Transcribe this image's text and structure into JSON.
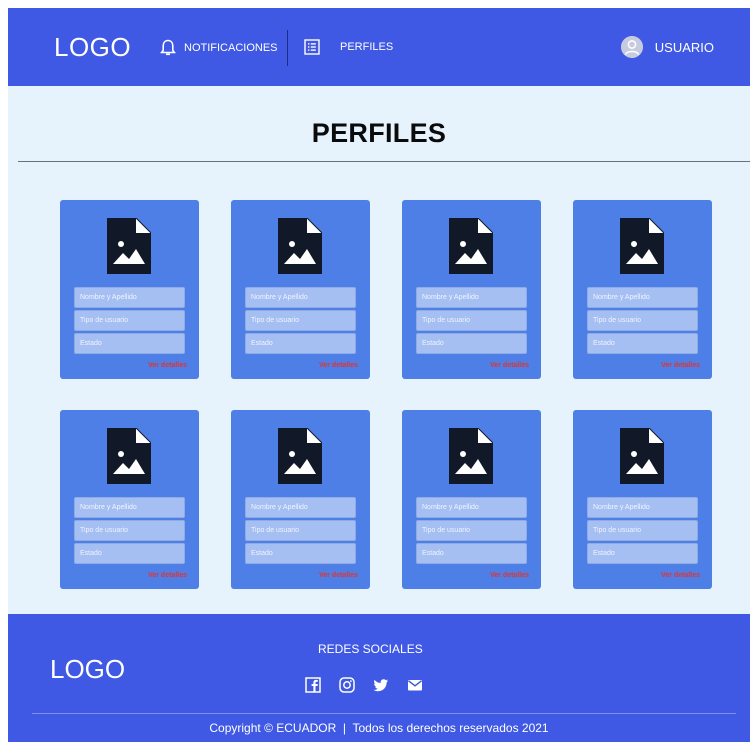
{
  "header": {
    "logo": "LOGO",
    "nav": {
      "notifications_label": "NOTIFICACIONES",
      "profiles_label": "PERFILES"
    },
    "user_label": "USUARIO"
  },
  "main": {
    "title": "PERFILES",
    "cards": [
      {
        "name_placeholder": "Nombre y Apellido",
        "type_placeholder": "Tipo de usuario",
        "status_placeholder": "Estado",
        "link": "Ver detalles"
      },
      {
        "name_placeholder": "Nombre y Apellido",
        "type_placeholder": "Tipo de usuario",
        "status_placeholder": "Estado",
        "link": "Ver detalles"
      },
      {
        "name_placeholder": "Nombre y Apellido",
        "type_placeholder": "Tipo de usuario",
        "status_placeholder": "Estado",
        "link": "Ver detalles"
      },
      {
        "name_placeholder": "Nombre y Apellido",
        "type_placeholder": "Tipo de usuario",
        "status_placeholder": "Estado",
        "link": "Ver detalles"
      },
      {
        "name_placeholder": "Nombre y Apellido",
        "type_placeholder": "Tipo de usuario",
        "status_placeholder": "Estado",
        "link": "Ver detalles"
      },
      {
        "name_placeholder": "Nombre y Apellido",
        "type_placeholder": "Tipo de usuario",
        "status_placeholder": "Estado",
        "link": "Ver detalles"
      },
      {
        "name_placeholder": "Nombre y Apellido",
        "type_placeholder": "Tipo de usuario",
        "status_placeholder": "Estado",
        "link": "Ver detalles"
      },
      {
        "name_placeholder": "Nombre y Apellido",
        "type_placeholder": "Tipo de usuario",
        "status_placeholder": "Estado",
        "link": "Ver detalles"
      }
    ]
  },
  "footer": {
    "logo": "LOGO",
    "social_title": "REDES SOCIALES",
    "social_icons": [
      "facebook-icon",
      "instagram-icon",
      "twitter-icon",
      "mail-icon"
    ],
    "copyright": "Copyright © ECUADOR  |  Todos los derechos reservados 2021"
  },
  "colors": {
    "header_footer": "#3F59E4",
    "background": "#E6F3FD",
    "card": "#4D7FE6",
    "field": "#A5BFF3",
    "link": "#E3342F",
    "icon_dark": "#111827"
  }
}
